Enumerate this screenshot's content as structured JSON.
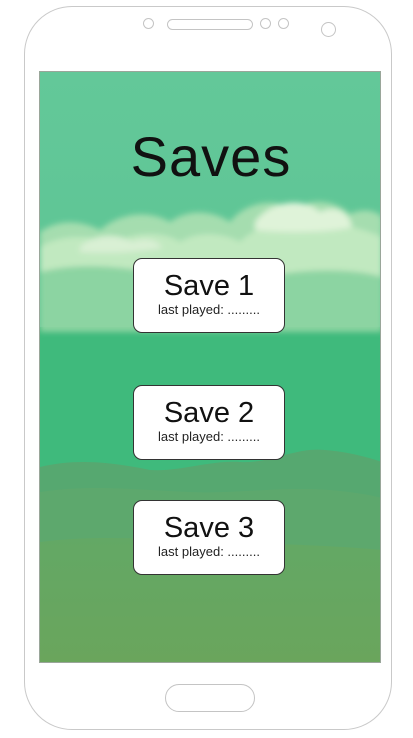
{
  "screen": {
    "title": "Saves"
  },
  "save_slots": [
    {
      "label": "Save 1",
      "subtitle": "last played: ........."
    },
    {
      "label": "Save 2",
      "subtitle": "last played: ........."
    },
    {
      "label": "Save 3",
      "subtitle": "last played: ........."
    }
  ],
  "colors": {
    "sky": "#5cc393",
    "meadow": "#3fba7c",
    "hills": "#56a870",
    "ground": "#66a760"
  }
}
